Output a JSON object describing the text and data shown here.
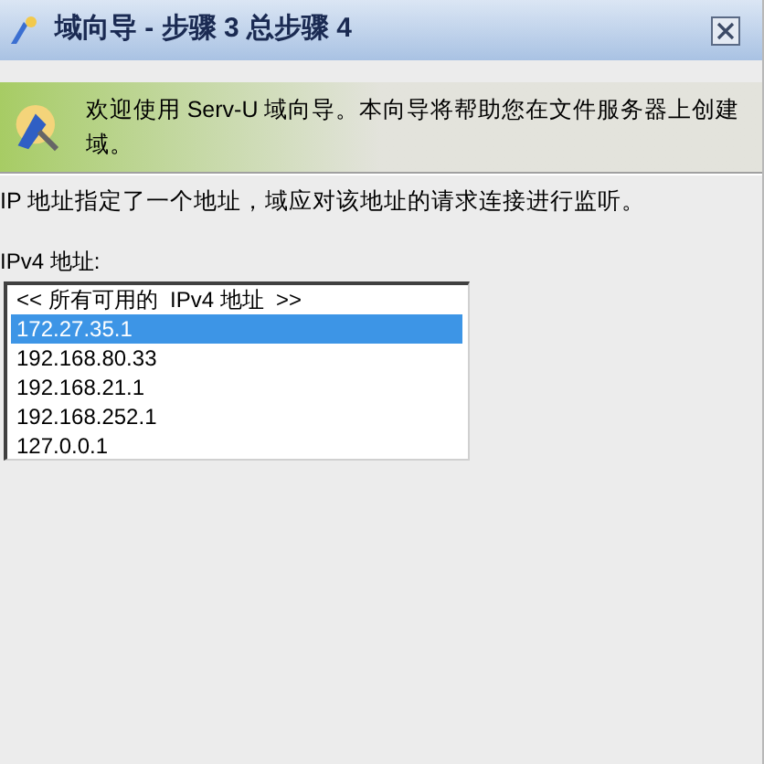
{
  "window": {
    "title": "域向导 - 步骤 3 总步骤 4"
  },
  "banner": {
    "text": "欢迎使用 Serv-U 域向导。本向导将帮助您在文件服务器上创建域。"
  },
  "description": "IP 地址指定了一个地址，域应对该地址的请求连接进行监听。",
  "address_list": {
    "label": "IPv4 地址:",
    "items": [
      {
        "text": "<< 所有可用的  IPv4 地址  >>",
        "selected": false
      },
      {
        "text": "172.27.35.1",
        "selected": true
      },
      {
        "text": "192.168.80.33",
        "selected": false
      },
      {
        "text": "192.168.21.1",
        "selected": false
      },
      {
        "text": "192.168.252.1",
        "selected": false
      },
      {
        "text": "127.0.0.1",
        "selected": false
      }
    ]
  }
}
